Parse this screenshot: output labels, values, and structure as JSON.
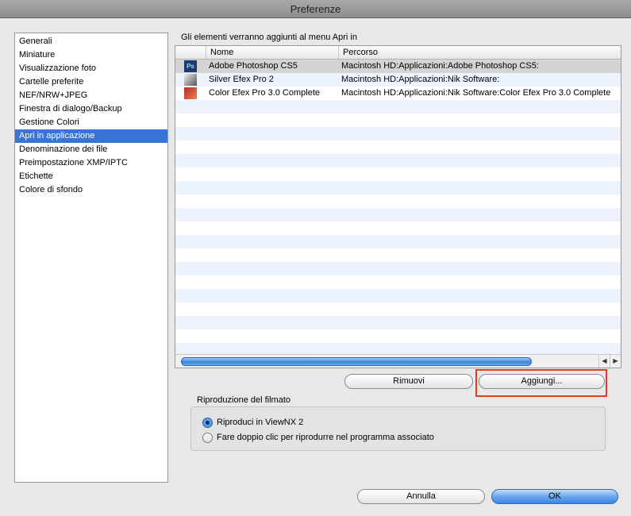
{
  "window": {
    "title": "Preferenze"
  },
  "sidebar": {
    "items": [
      {
        "label": "Generali"
      },
      {
        "label": "Miniature"
      },
      {
        "label": "Visualizzazione foto"
      },
      {
        "label": "Cartelle preferite"
      },
      {
        "label": "NEF/NRW+JPEG"
      },
      {
        "label": "Finestra di dialogo/Backup"
      },
      {
        "label": "Gestione Colori"
      },
      {
        "label": "Apri in applicazione"
      },
      {
        "label": "Denominazione dei file"
      },
      {
        "label": "Preimpostazione XMP/IPTC"
      },
      {
        "label": "Etichette"
      },
      {
        "label": "Colore di sfondo"
      }
    ],
    "selected": "Apri in applicazione"
  },
  "apps": {
    "caption": "Gli elementi verranno aggiunti al menu Apri in",
    "columns": {
      "name": "Nome",
      "path": "Percorso"
    },
    "rows": [
      {
        "icon": "photoshop-icon",
        "icon_text": "Ps",
        "name": "Adobe Photoshop CS5",
        "path": "Macintosh HD:Applicazioni:Adobe Photoshop CS5:"
      },
      {
        "icon": "silver-efex-icon",
        "name": "Silver Efex Pro 2",
        "path": "Macintosh HD:Applicazioni:Nik Software:"
      },
      {
        "icon": "color-efex-icon",
        "name": "Color Efex Pro 3.0 Complete",
        "path": "Macintosh HD:Applicazioni:Nik Software:Color Efex Pro 3.0 Complete"
      }
    ],
    "scroll_left_arrow": "◀",
    "scroll_right_arrow": "▶",
    "remove_label": "Rimuovi",
    "add_label": "Aggiungi..."
  },
  "playback": {
    "title": "Riproduzione del filmato",
    "options": [
      {
        "label": "Riproduci in ViewNX 2",
        "selected": true
      },
      {
        "label": "Fare doppio clic per riprodurre nel programma associato",
        "selected": false
      }
    ]
  },
  "footer": {
    "cancel_label": "Annulla",
    "ok_label": "OK"
  }
}
